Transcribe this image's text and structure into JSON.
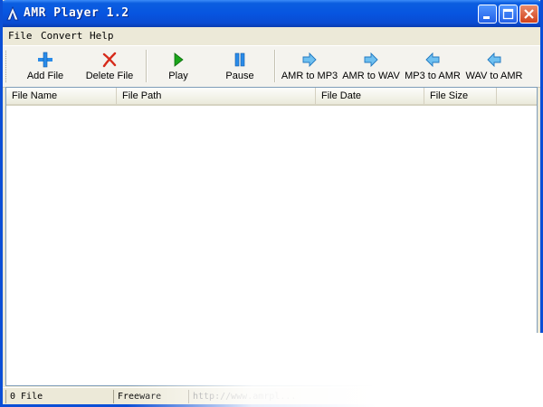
{
  "window": {
    "title": "AMR Player 1.2"
  },
  "title_buttons": [
    {
      "icon": "minimize-icon"
    },
    {
      "icon": "maximize-icon"
    },
    {
      "icon": "close-icon"
    }
  ],
  "menu": {
    "items": [
      "File",
      "Convert",
      "Help"
    ]
  },
  "toolbar": {
    "buttons": [
      {
        "label": "Add File",
        "icon": "plus-icon",
        "color": "#2a8be8"
      },
      {
        "label": "Delete File",
        "icon": "x-icon",
        "color": "#d62a1a"
      },
      {
        "label": "Play",
        "icon": "play-icon",
        "color": "#1aa51a"
      },
      {
        "label": "Pause",
        "icon": "pause-icon",
        "color": "#2a8be8"
      },
      {
        "label": "AMR to MP3",
        "icon": "arrow-right-icon",
        "color": "#3aa0e8"
      },
      {
        "label": "AMR to WAV",
        "icon": "arrow-right-icon",
        "color": "#3aa0e8"
      },
      {
        "label": "MP3 to AMR",
        "icon": "arrow-left-icon",
        "color": "#3aa0e8"
      },
      {
        "label": "WAV to AMR",
        "icon": "arrow-left-icon",
        "color": "#3aa0e8"
      }
    ]
  },
  "table": {
    "columns": [
      "File Name",
      "File Path",
      "File Date",
      "File Size"
    ],
    "rows": []
  },
  "status": {
    "count": "0 File",
    "license": "Freeware",
    "url": "http://www.amrpl..."
  },
  "colors": {
    "titlebar": "#0755e0",
    "accent": "#2a8be8"
  }
}
